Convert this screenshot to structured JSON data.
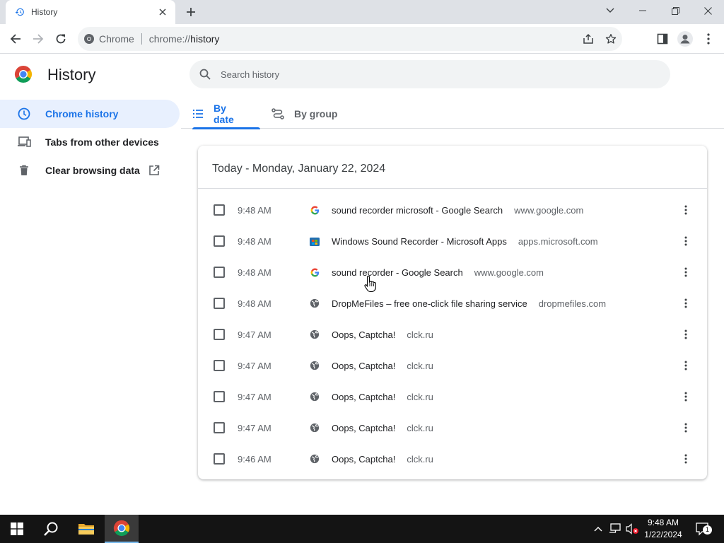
{
  "browser": {
    "tab_title": "History",
    "omnibox_site_label": "Chrome",
    "omnibox_url_scheme": "chrome://",
    "omnibox_url_path": "history"
  },
  "page": {
    "title": "History",
    "search_placeholder": "Search history"
  },
  "sidebar": {
    "items": [
      {
        "label": "Chrome history",
        "icon": "clock-icon",
        "active": true
      },
      {
        "label": "Tabs from other devices",
        "icon": "devices-icon",
        "active": false
      },
      {
        "label": "Clear browsing data",
        "icon": "trash-icon",
        "active": false
      }
    ]
  },
  "tabs": [
    {
      "label": "By date",
      "icon": "list-icon",
      "active": true
    },
    {
      "label": "By group",
      "icon": "journeys-icon",
      "active": false
    }
  ],
  "history": {
    "day_heading": "Today - Monday, January 22, 2024",
    "entries": [
      {
        "time": "9:48 AM",
        "title": "sound recorder microsoft - Google Search",
        "domain": "www.google.com",
        "favicon": "google-icon"
      },
      {
        "time": "9:48 AM",
        "title": "Windows Sound Recorder - Microsoft Apps",
        "domain": "apps.microsoft.com",
        "favicon": "microsoft-store-icon"
      },
      {
        "time": "9:48 AM",
        "title": "sound recorder - Google Search",
        "domain": "www.google.com",
        "favicon": "google-icon"
      },
      {
        "time": "9:48 AM",
        "title": "DropMeFiles – free one-click file sharing service",
        "domain": "dropmefiles.com",
        "favicon": "globe-icon"
      },
      {
        "time": "9:47 AM",
        "title": "Oops, Captcha!",
        "domain": "clck.ru",
        "favicon": "globe-icon"
      },
      {
        "time": "9:47 AM",
        "title": "Oops, Captcha!",
        "domain": "clck.ru",
        "favicon": "globe-icon"
      },
      {
        "time": "9:47 AM",
        "title": "Oops, Captcha!",
        "domain": "clck.ru",
        "favicon": "globe-icon"
      },
      {
        "time": "9:47 AM",
        "title": "Oops, Captcha!",
        "domain": "clck.ru",
        "favicon": "globe-icon"
      },
      {
        "time": "9:46 AM",
        "title": "Oops, Captcha!",
        "domain": "clck.ru",
        "favicon": "globe-icon"
      }
    ]
  },
  "taskbar": {
    "time": "9:48 AM",
    "date": "1/22/2024",
    "notification_count": "1"
  },
  "colors": {
    "accent": "#1a73e8",
    "sidebar_active_bg": "#e8f0fe",
    "tabstrip_bg": "#dee1e6",
    "taskbar_bg": "#141414"
  }
}
